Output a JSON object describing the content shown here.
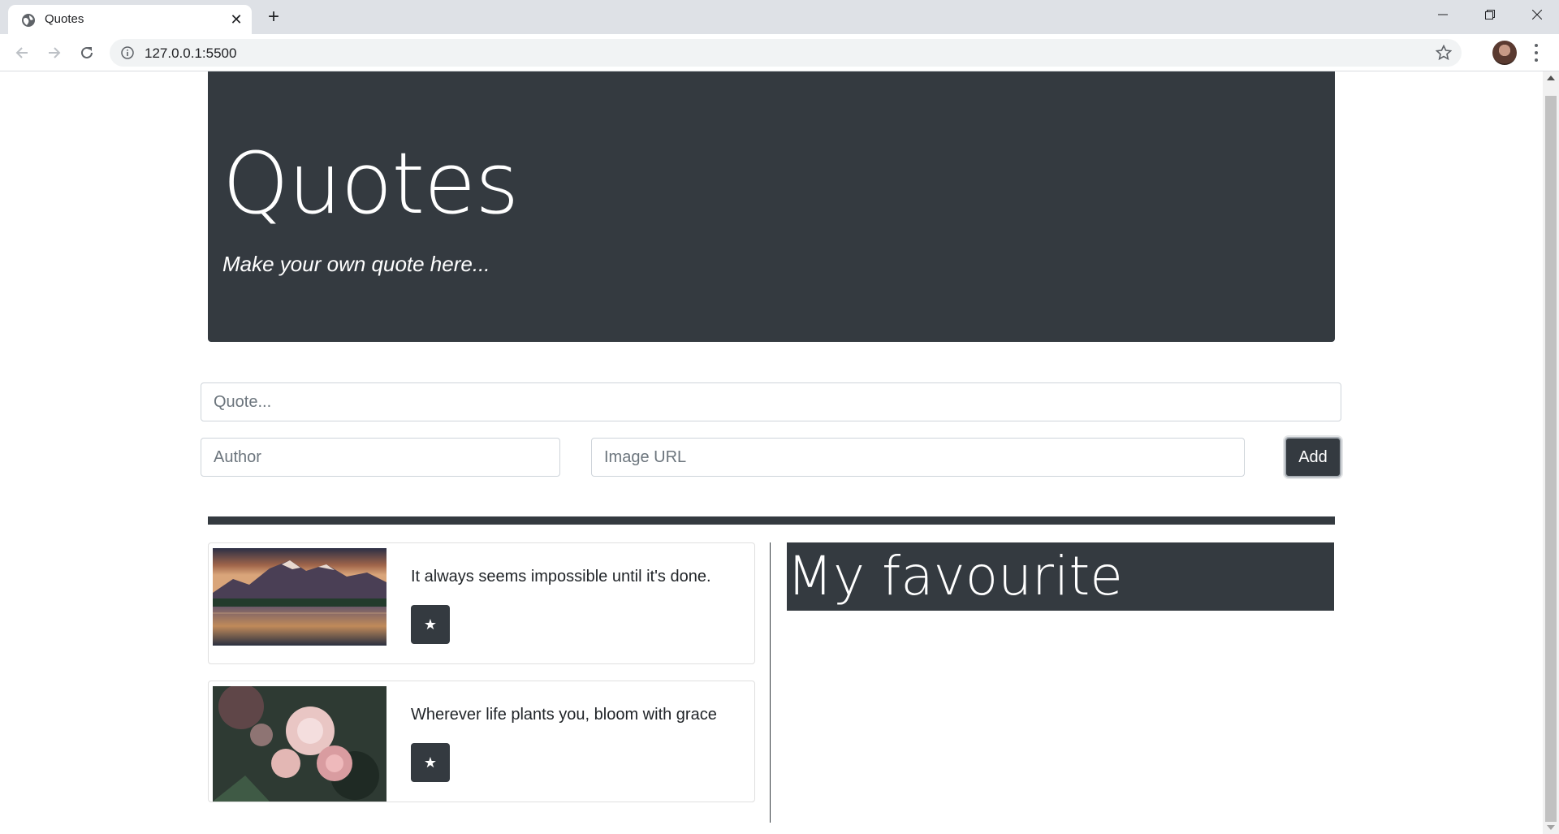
{
  "browser": {
    "tab_title": "Quotes",
    "tab_favicon": "globe-icon",
    "url": "127.0.0.1:5500"
  },
  "page": {
    "title": "Quotes",
    "subtitle": "Make your own quote here..."
  },
  "form": {
    "quote_placeholder": "Quote...",
    "author_placeholder": "Author",
    "image_placeholder": "Image URL",
    "add_label": "Add"
  },
  "quotes": [
    {
      "text": "It always seems impossible until it's done.",
      "star_label": "★",
      "image": "mountain-lake-photo"
    },
    {
      "text": "Wherever life plants you, bloom with grace",
      "star_label": "★",
      "image": "pink-roses-photo"
    }
  ],
  "favourites": {
    "title": "My favourite"
  },
  "colors": {
    "dark": "#343a40",
    "tabbar": "#dee1e6"
  }
}
